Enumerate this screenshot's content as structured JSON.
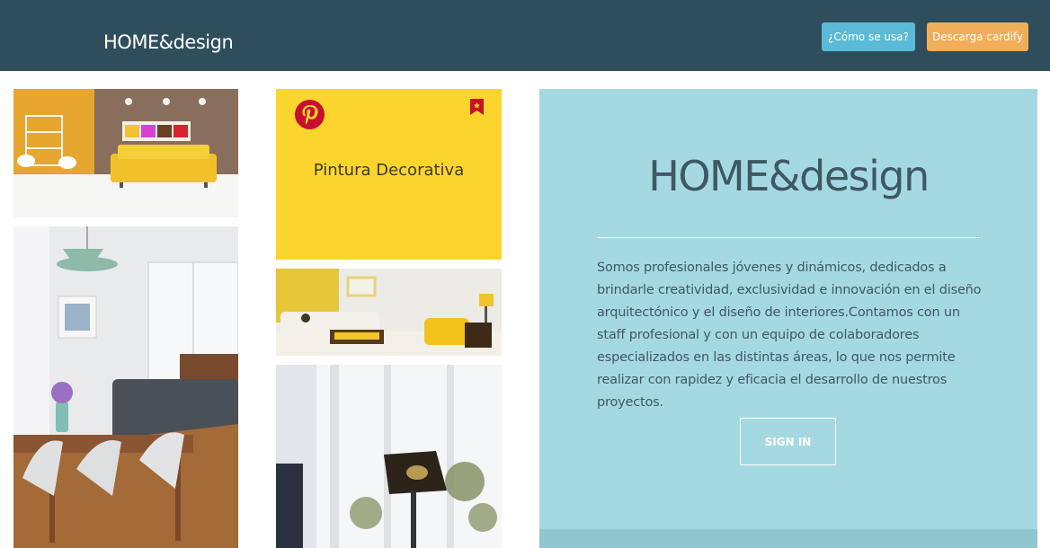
{
  "header": {
    "brand": "HOME&design",
    "help_button": "¿Cómo se usa?",
    "download_button": "Descarga cardify"
  },
  "card": {
    "icon": "pinterest-icon",
    "bookmark_icon": "bookmark-icon",
    "title": "Pintura Decorativa"
  },
  "panel": {
    "title": "HOME&design",
    "description": "Somos profesionales jóvenes y dinámicos, dedicados a brindarle creatividad, exclusividad e innovación en el diseño arquitectónico y el diseño de interiores.Contamos con un staff profesional y con un equipo de colaboradores especializados en las distintas áreas, lo que nos permite realizar con rapidez y eficacia el desarrollo de nuestros proyectos.",
    "signin_button": "SIGN IN"
  },
  "colors": {
    "header_bg": "#2f4e5c",
    "help_button": "#5bbad5",
    "download_button": "#f0ad5a",
    "card_yellow": "#fbd52e",
    "pinterest_red": "#c8102e",
    "panel_bg": "#a5d9e2"
  }
}
